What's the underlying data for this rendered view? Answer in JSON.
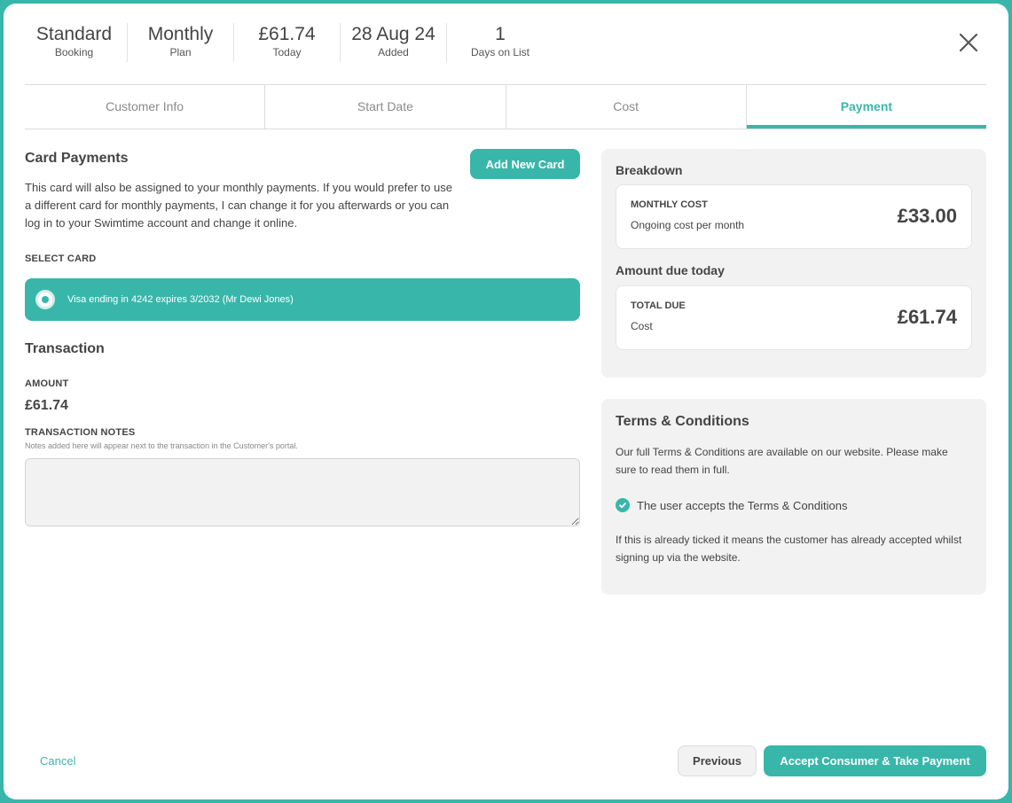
{
  "header": {
    "stats": [
      {
        "value": "Standard",
        "label": "Booking"
      },
      {
        "value": "Monthly",
        "label": "Plan"
      },
      {
        "value": "£61.74",
        "label": "Today"
      },
      {
        "value": "28 Aug 24",
        "label": "Added"
      },
      {
        "value": "1",
        "label": "Days on List"
      }
    ],
    "close_icon": "close-icon"
  },
  "tabs": [
    {
      "label": "Customer Info",
      "active": false
    },
    {
      "label": "Start Date",
      "active": false
    },
    {
      "label": "Cost",
      "active": false
    },
    {
      "label": "Payment",
      "active": true
    }
  ],
  "card_payments": {
    "title": "Card Payments",
    "add_button": "Add New Card",
    "description": "This card will also be assigned to your monthly payments. If you would prefer to use a different card for monthly payments, I can change it for you afterwards or you can log in to your Swimtime account and change it online.",
    "select_label": "SELECT CARD",
    "selected_card": "Visa ending in 4242 expires 3/2032 (Mr Dewi Jones)"
  },
  "transaction": {
    "title": "Transaction",
    "amount_label": "AMOUNT",
    "amount_value": "£61.74",
    "notes_label": "TRANSACTION NOTES",
    "notes_hint": "Notes added here will appear next to the transaction in the Customer's portal.",
    "notes_value": ""
  },
  "breakdown": {
    "title": "Breakdown",
    "monthly": {
      "title": "MONTHLY COST",
      "subtitle": "Ongoing cost per month",
      "value": "£33.00"
    },
    "due_title": "Amount due today",
    "total": {
      "title": "TOTAL DUE",
      "subtitle": "Cost",
      "value": "£61.74"
    }
  },
  "terms": {
    "title": "Terms & Conditions",
    "text": "Our full Terms & Conditions are available on our website. Please make sure to read them in full.",
    "checkbox_label": "The user accepts the Terms & Conditions",
    "checked": true,
    "note": "If this is already ticked it means the customer has already accepted whilst signing up via the website."
  },
  "footer": {
    "cancel": "Cancel",
    "previous": "Previous",
    "accept": "Accept Consumer & Take Payment"
  },
  "colors": {
    "accent": "#39b6aa",
    "panel_bg": "#f2f2f2"
  }
}
